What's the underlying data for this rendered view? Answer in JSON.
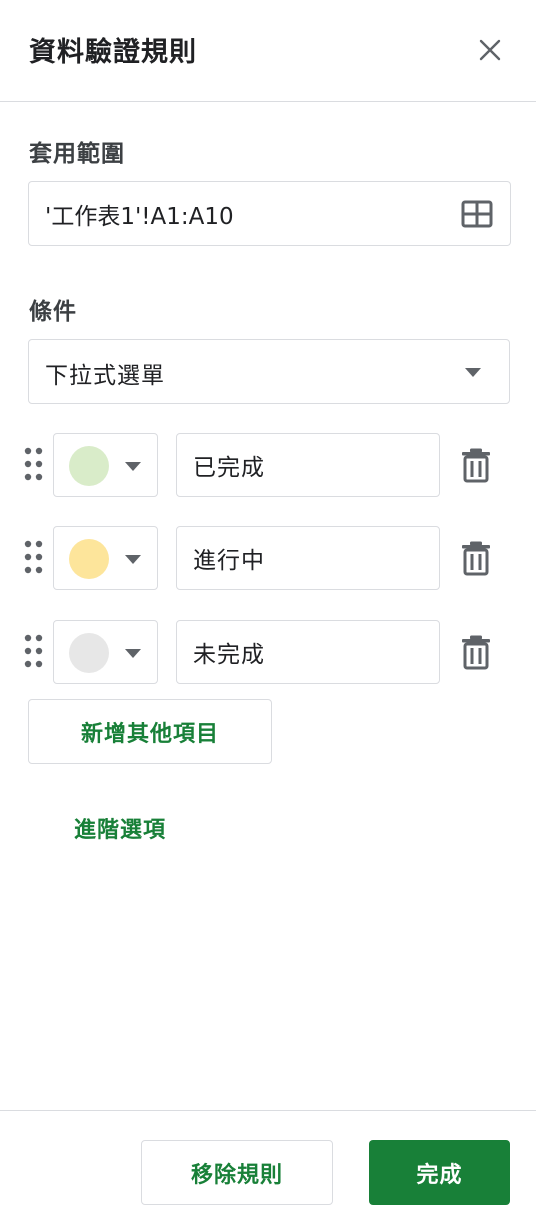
{
  "header": {
    "title": "資料驗證規則",
    "close_icon": "close-icon"
  },
  "range": {
    "label": "套用範圍",
    "value": "'工作表1'!A1:A10",
    "icon": "grid-select-icon"
  },
  "criteria": {
    "label": "條件",
    "selected": "下拉式選單"
  },
  "items": [
    {
      "color": "#d9ecc9",
      "value": "已完成"
    },
    {
      "color": "#fde59b",
      "value": "進行中"
    },
    {
      "color": "#e7e7e7",
      "value": "未完成"
    }
  ],
  "actions": {
    "add_item": "新增其他項目",
    "advanced": "進階選項",
    "remove_rule": "移除規則",
    "done": "完成"
  },
  "colors": {
    "accent": "#188038",
    "border": "#dadce0",
    "icon": "#5f6368"
  }
}
